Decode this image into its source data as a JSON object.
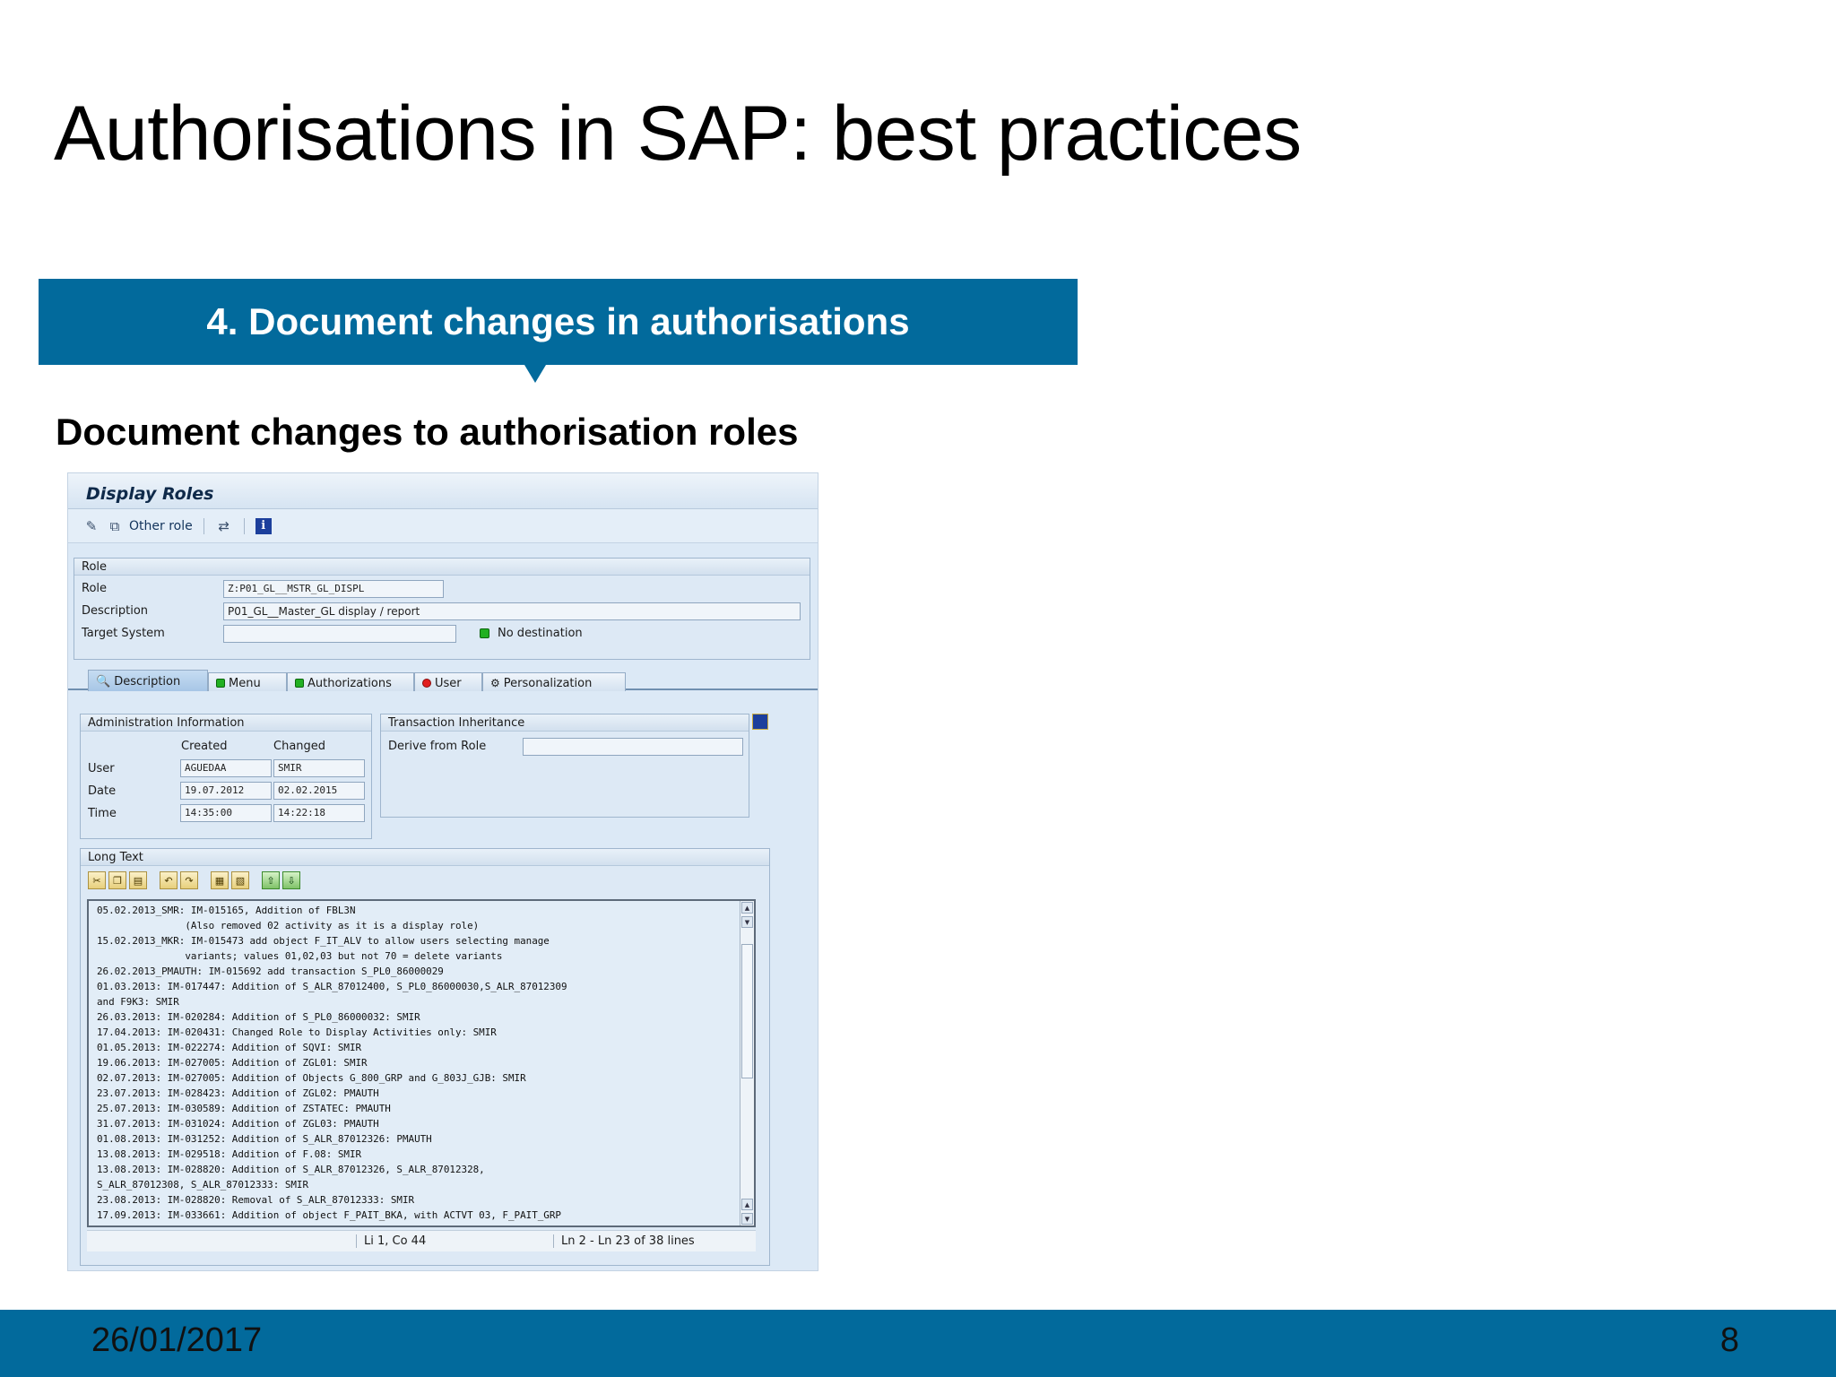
{
  "slide": {
    "title": "Authorisations in SAP: best practices",
    "banner": "4. Document changes in authorisations",
    "subheading": "Document changes to authorisation roles",
    "footer_date": "26/01/2017",
    "footer_page": "8"
  },
  "colors": {
    "accent_blue": "#026a9c",
    "sap_panel": "#dce9f6"
  },
  "sap": {
    "window_title": "Display Roles",
    "toolbar": {
      "other_role_label": "Other role"
    },
    "role_group": {
      "title": "Role",
      "role_label": "Role",
      "role_value": "Z:P01_GL__MSTR_GL_DISPL",
      "description_label": "Description",
      "description_value": "P01_GL__Master_GL display / report",
      "target_system_label": "Target System",
      "target_system_value": "",
      "destination_status": "No destination"
    },
    "tabs": [
      {
        "label": "Description"
      },
      {
        "label": "Menu"
      },
      {
        "label": "Authorizations"
      },
      {
        "label": "User"
      },
      {
        "label": "Personalization"
      }
    ],
    "admin_info": {
      "title": "Administration Information",
      "col_created": "Created",
      "col_changed": "Changed",
      "user_label": "User",
      "user_created": "AGUEDAA",
      "user_changed": "SMIR",
      "date_label": "Date",
      "date_created": "19.07.2012",
      "date_changed": "02.02.2015",
      "time_label": "Time",
      "time_created": "14:35:00",
      "time_changed": "14:22:18"
    },
    "inheritance": {
      "title": "Transaction Inheritance",
      "derive_label": "Derive from Role",
      "derive_value": ""
    },
    "long_text": {
      "title": "Long Text",
      "text": "05.02.2013_SMR: IM-015165, Addition of FBL3N\n               (Also removed 02 activity as it is a display role)\n15.02.2013_MKR: IM-015473 add object F_IT_ALV to allow users selecting manage\n               variants; values 01,02,03 but not 70 = delete variants\n26.02.2013_PMAUTH: IM-015692 add transaction S_PL0_86000029\n01.03.2013: IM-017447: Addition of S_ALR_87012400, S_PL0_86000030,S_ALR_87012309\nand F9K3: SMIR\n26.03.2013: IM-020284: Addition of S_PL0_86000032: SMIR\n17.04.2013: IM-020431: Changed Role to Display Activities only: SMIR\n01.05.2013: IM-022274: Addition of SQVI: SMIR\n19.06.2013: IM-027005: Addition of ZGL01: SMIR\n02.07.2013: IM-027005: Addition of Objects G_800_GRP and G_803J_GJB: SMIR\n23.07.2013: IM-028423: Addition of ZGL02: PMAUTH\n25.07.2013: IM-030589: Addition of ZSTATEC: PMAUTH\n31.07.2013: IM-031024: Addition of ZGL03: PMAUTH\n01.08.2013: IM-031252: Addition of S_ALR_87012326: PMAUTH\n13.08.2013: IM-029518: Addition of F.08: SMIR\n13.08.2013: IM-028820: Addition of S_ALR_87012326, S_ALR_87012328,\nS_ALR_87012308, S_ALR_87012333: SMIR\n23.08.2013: IM-028820: Removal of S_ALR_87012333: SMIR\n17.09.2013: IM-033661: Addition of object F_PAIT_BKA, with ACTVT 03, F_PAIT_GRP",
      "cursor_pos": "Li 1, Co 44",
      "line_range": "Ln 2 - Ln 23 of 38 lines"
    }
  }
}
